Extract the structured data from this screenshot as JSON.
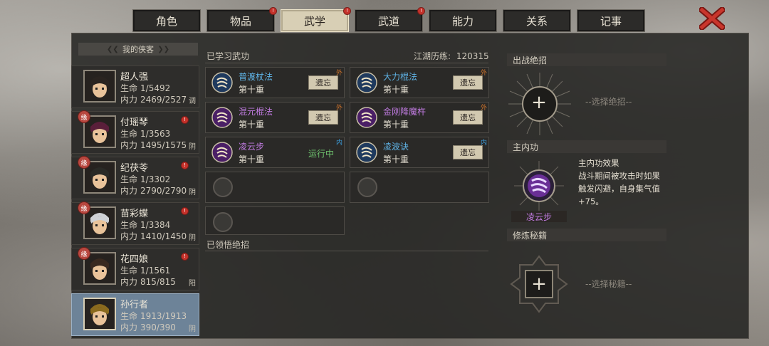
{
  "tabs": [
    {
      "label": "角色",
      "dot": false,
      "active": false
    },
    {
      "label": "物品",
      "dot": true,
      "active": false
    },
    {
      "label": "武学",
      "dot": true,
      "active": true
    },
    {
      "label": "武道",
      "dot": true,
      "active": false
    },
    {
      "label": "能力",
      "dot": false,
      "active": false
    },
    {
      "label": "关系",
      "dot": false,
      "active": false
    },
    {
      "label": "记事",
      "dot": false,
      "active": false
    }
  ],
  "dot_glyph": "!",
  "close_icon": "close-x-icon",
  "colors": {
    "accent_tab": "#d8cfb5",
    "selected_card": "#6d8398",
    "skill_blue": "#5fb3e6",
    "skill_purple": "#c07be0",
    "running_green": "#6fc46f",
    "wai_orange": "#d0742b",
    "nei_blue": "#3b9bd8"
  },
  "heroes": {
    "title": "我的侠客",
    "stat_hp": "生命",
    "stat_mp": "内力",
    "items": [
      {
        "name": "超人强",
        "hp": "1/5492",
        "mp": "2469/2527",
        "tag": "调",
        "yuan": false,
        "dot": false,
        "active": false
      },
      {
        "name": "付瑶琴",
        "hp": "1/3563",
        "mp": "1495/1575",
        "tag": "阴",
        "yuan": true,
        "dot": true,
        "active": false
      },
      {
        "name": "纪茯苓",
        "hp": "1/3302",
        "mp": "2790/2790",
        "tag": "阴",
        "yuan": true,
        "dot": true,
        "active": false
      },
      {
        "name": "苗彩蝶",
        "hp": "1/3384",
        "mp": "1410/1450",
        "tag": "阴",
        "yuan": true,
        "dot": true,
        "active": false
      },
      {
        "name": "花四娘",
        "hp": "1/1561",
        "mp": "815/815",
        "tag": "阳",
        "yuan": true,
        "dot": true,
        "active": false
      },
      {
        "name": "孙行者",
        "hp": "1913/1913",
        "mp": "390/390",
        "tag": "阴",
        "yuan": false,
        "dot": false,
        "active": true
      }
    ],
    "yuan_label": "缘"
  },
  "learned": {
    "title": "已学习武功",
    "exp_label": "江湖历练:",
    "exp_value": "120315",
    "forget_label": "遗忘",
    "running_label": "运行中",
    "skills": [
      {
        "name": "普渡杖法",
        "level": "第十重",
        "type": "外",
        "color": "blue",
        "running": false
      },
      {
        "name": "大力棍法",
        "level": "第十重",
        "type": "外",
        "color": "blue",
        "running": false
      },
      {
        "name": "混元棍法",
        "level": "第十重",
        "type": "外",
        "color": "purple",
        "running": false
      },
      {
        "name": "金刚降魔杵",
        "level": "第十重",
        "type": "外",
        "color": "purple",
        "running": false
      },
      {
        "name": "凌云步",
        "level": "第十重",
        "type": "内",
        "color": "purple",
        "running": true
      },
      {
        "name": "凌波诀",
        "level": "第十重",
        "type": "内",
        "color": "blue",
        "running": false
      }
    ]
  },
  "realized": {
    "title": "已领悟绝招"
  },
  "right": {
    "ultimate_title": "出战绝招",
    "ultimate_hint": "--选择绝招--",
    "inner_title": "主内功",
    "inner_effect_title": "主内功效果",
    "inner_effect_text": [
      "战斗期间被攻击时如果",
      "触发闪避，自身集气值",
      "+75。"
    ],
    "inner_skill_name": "凌云步",
    "manual_title": "修炼秘籍",
    "manual_hint": "--选择秘籍--",
    "plus_glyph": "+"
  }
}
